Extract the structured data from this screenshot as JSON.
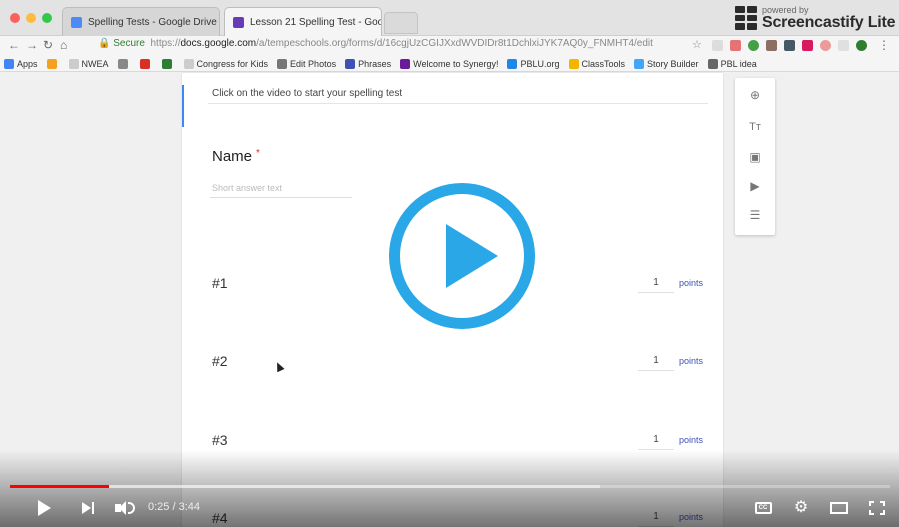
{
  "browser": {
    "tabs": [
      {
        "title": "Spelling Tests - Google Drive",
        "close": "×",
        "favicon_color": "#4c8bf5"
      },
      {
        "title": "Lesson 21 Spelling Test - Goo",
        "close": "×",
        "favicon_color": "#673ab7"
      }
    ],
    "url": {
      "secure_label": "Secure",
      "scheme": "https://",
      "domain": "docs.google.com",
      "path": "/a/tempeschools.org/forms/d/16cgjUzCGIJXxdWVDIDr8t1DchlxiJYK7AQ0y_FNMHT4/edit"
    },
    "bookmarks": [
      {
        "label": "Apps",
        "color": "#4285f4"
      },
      {
        "label": "",
        "color": "#f4a020"
      },
      {
        "label": "NWEA",
        "color": "#cccccc"
      },
      {
        "label": "",
        "color": "#888888"
      },
      {
        "label": "",
        "color": "#d93025"
      },
      {
        "label": "",
        "color": "#2e7d32"
      },
      {
        "label": "Congress for Kids",
        "color": "#cccccc"
      },
      {
        "label": "Edit Photos",
        "color": "#777777"
      },
      {
        "label": "Phrases",
        "color": "#3f51b5"
      },
      {
        "label": "Welcome to Synergy!",
        "color": "#6a1b9a"
      },
      {
        "label": "PBLU.org",
        "color": "#1e88e5"
      },
      {
        "label": "ClassTools",
        "color": "#f4b400"
      },
      {
        "label": "Story Builder",
        "color": "#42a5f5"
      },
      {
        "label": "PBL idea",
        "color": "#666666"
      }
    ]
  },
  "screencastify": {
    "small": "powered by",
    "big": "Screencastify Lite"
  },
  "form": {
    "description": "Click on the video to start your spelling test",
    "name_label": "Name",
    "required_mark": "*",
    "short_answer": "Short answer text",
    "questions": [
      {
        "label": "#1",
        "points": "1",
        "points_label": "points"
      },
      {
        "label": "#2",
        "points": "1",
        "points_label": "points"
      },
      {
        "label": "#3",
        "points": "1",
        "points_label": "points"
      },
      {
        "label": "#4",
        "points": "1",
        "points_label": "points"
      }
    ],
    "drag_handle": "⁝⁝⁝"
  },
  "player": {
    "current_time": "0:25",
    "separator": " / ",
    "duration": "3:44",
    "progress_fraction": 0.112,
    "buffered_fraction": 0.67,
    "cc_label": "CC",
    "accent_color": "#ff0000",
    "big_play_color": "#2aa7e6"
  }
}
